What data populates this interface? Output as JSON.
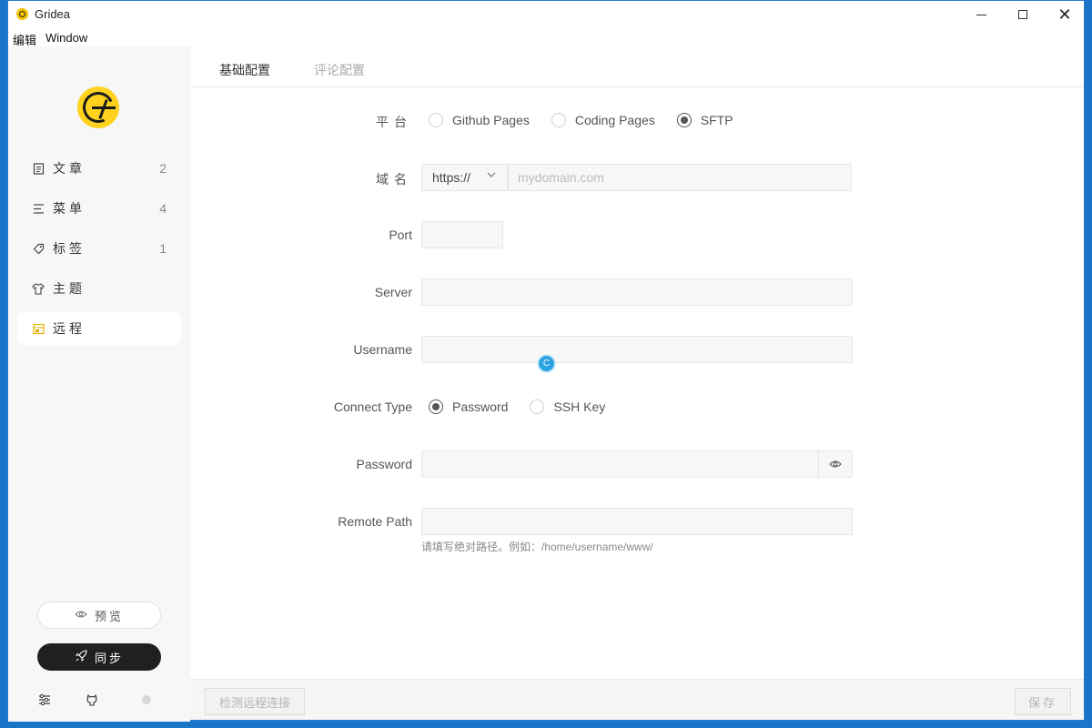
{
  "window": {
    "title": "Gridea",
    "min_label": "",
    "max_label": "",
    "close_label": "✕"
  },
  "menubar": {
    "edit": "编辑",
    "window": "Window"
  },
  "sidebar": {
    "items": [
      {
        "label": "文章",
        "count": "2",
        "icon": "document-icon"
      },
      {
        "label": "菜单",
        "count": "4",
        "icon": "menu-icon"
      },
      {
        "label": "标签",
        "count": "1",
        "icon": "tag-icon"
      },
      {
        "label": "主题",
        "count": "",
        "icon": "shirt-icon"
      },
      {
        "label": "远程",
        "count": "",
        "icon": "remote-icon"
      }
    ],
    "active": "远程",
    "preview_label": "预览",
    "sync_label": "同步"
  },
  "tabs": {
    "basic": "基础配置",
    "comment": "评论配置"
  },
  "form": {
    "platform": {
      "label": "平台",
      "options": [
        "Github Pages",
        "Coding Pages",
        "SFTP"
      ],
      "selected": "SFTP"
    },
    "domain": {
      "label": "域名",
      "protocol": "https://",
      "placeholder": "mydomain.com",
      "value": ""
    },
    "port": {
      "label": "Port",
      "value": ""
    },
    "server": {
      "label": "Server",
      "value": ""
    },
    "username": {
      "label": "Username",
      "value": ""
    },
    "connect_type": {
      "label": "Connect Type",
      "options": [
        "Password",
        "SSH Key"
      ],
      "selected": "Password"
    },
    "password": {
      "label": "Password",
      "value": ""
    },
    "remote_path": {
      "label": "Remote Path",
      "value": "",
      "hint": "请填写绝对路径。例如：/home/username/www/"
    }
  },
  "cursor": {
    "glyph": "C"
  },
  "actions": {
    "check_connection": "检测远程连接",
    "save": "保存"
  },
  "colors": {
    "accent": "#ffd21f",
    "sync_bg": "#202020",
    "cursor": "#2aa3e0"
  }
}
